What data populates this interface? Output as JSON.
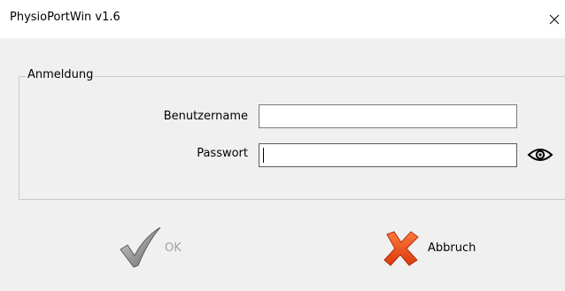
{
  "window": {
    "title": "PhysioPortWin v1.6",
    "close_icon": "close-icon"
  },
  "login_group": {
    "legend": "Anmeldung",
    "username_label": "Benutzername",
    "username_value": "",
    "password_label": "Passwort",
    "password_value": "",
    "password_toggle_icon": "eye-icon"
  },
  "buttons": {
    "ok_label": "OK",
    "ok_icon": "checkmark-icon",
    "ok_enabled": false,
    "cancel_label": "Abbruch",
    "cancel_icon": "red-x-icon"
  },
  "colors": {
    "background": "#f0f0f0",
    "titlebar": "#ffffff",
    "disabled_text": "#a0a0a0",
    "cancel_icon_color": "#e8501e"
  }
}
